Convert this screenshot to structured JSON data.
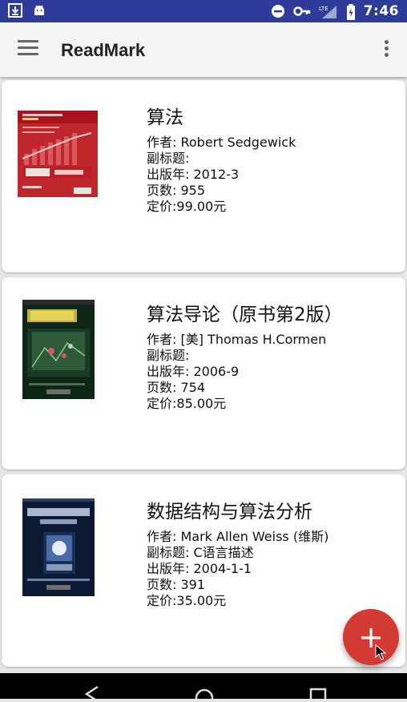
{
  "status_bar": {
    "time": "7:46",
    "network": "LTE"
  },
  "app_bar": {
    "title": "ReadMark"
  },
  "books": [
    {
      "title": "算法",
      "author": "作者: Robert Sedgewick",
      "subtitle": "副标题:",
      "pubdate": "出版年: 2012-3",
      "pages": "页数: 955",
      "price": "定价:99.00元",
      "cover_color": "#c0272d"
    },
    {
      "title": "算法导论（原书第2版）",
      "author": "作者: [美] Thomas H.Cormen",
      "subtitle": "副标题:",
      "pubdate": "出版年: 2006-9",
      "pages": "页数: 754",
      "price": "定价:85.00元",
      "cover_color": "#0d2616"
    },
    {
      "title": "数据结构与算法分析",
      "author": "作者: Mark Allen Weiss (维斯)",
      "subtitle": "副标题: C语言描述",
      "pubdate": "出版年: 2004-1-1",
      "pages": "页数: 391",
      "price": "定价:35.00元",
      "cover_color": "#0c1b33"
    }
  ],
  "fab": {
    "label": "+"
  },
  "colors": {
    "status_bar": "#2e3b98",
    "accent": "#d33a34"
  }
}
